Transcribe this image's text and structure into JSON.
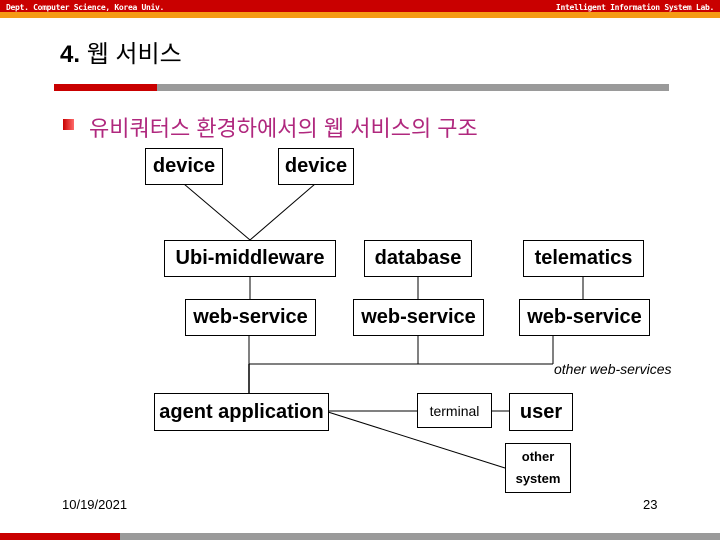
{
  "header": {
    "left_text": "Dept. Computer Science, Korea Univ.",
    "right_text": "Intelligent Information System Lab."
  },
  "slide": {
    "title_number": "4.",
    "title_text": "웹 서비스",
    "subtitle": "유비쿼터스 환경하에서의 웹 서비스의 구조"
  },
  "diagram": {
    "nodes": {
      "device_1": "device",
      "device_2": "device",
      "ubi_middleware": "Ubi-middleware",
      "database": "database",
      "telematics": "telematics",
      "web_service_1": "web-service",
      "web_service_2": "web-service",
      "web_service_3": "web-service",
      "agent_application": "agent application",
      "terminal": "terminal",
      "user": "user",
      "other_system_line1": "other",
      "other_system_line2": "system"
    },
    "labels": {
      "other_web_services": "other web-services"
    },
    "edges": [
      [
        "device_1",
        "ubi_middleware"
      ],
      [
        "device_2",
        "ubi_middleware"
      ],
      [
        "ubi_middleware",
        "web_service_1"
      ],
      [
        "database",
        "web_service_2"
      ],
      [
        "telematics",
        "web_service_3"
      ],
      [
        "web_service_1",
        "bus"
      ],
      [
        "web_service_2",
        "bus"
      ],
      [
        "web_service_3",
        "bus"
      ],
      [
        "bus",
        "agent_application"
      ],
      [
        "agent_application",
        "terminal"
      ],
      [
        "terminal",
        "user"
      ],
      [
        "agent_application",
        "other_system"
      ]
    ]
  },
  "footer": {
    "date": "10/19/2021",
    "page_number": "23"
  },
  "colors": {
    "header_red": "#c90000",
    "header_orange": "#f59a14",
    "rule_gray": "#9a9a9a",
    "subtitle_magenta": "#b0287e"
  }
}
